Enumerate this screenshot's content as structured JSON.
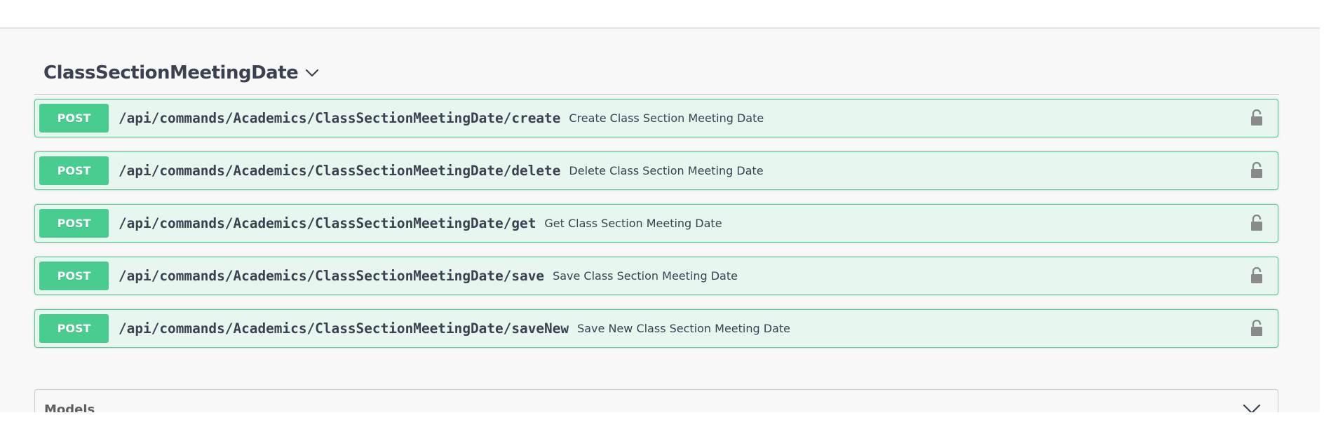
{
  "section": {
    "title": "ClassSectionMeetingDate"
  },
  "operations": [
    {
      "method": "POST",
      "path": "/api/commands/Academics/ClassSectionMeetingDate/create",
      "description": "Create Class Section Meeting Date"
    },
    {
      "method": "POST",
      "path": "/api/commands/Academics/ClassSectionMeetingDate/delete",
      "description": "Delete Class Section Meeting Date"
    },
    {
      "method": "POST",
      "path": "/api/commands/Academics/ClassSectionMeetingDate/get",
      "description": "Get Class Section Meeting Date"
    },
    {
      "method": "POST",
      "path": "/api/commands/Academics/ClassSectionMeetingDate/save",
      "description": "Save Class Section Meeting Date"
    },
    {
      "method": "POST",
      "path": "/api/commands/Academics/ClassSectionMeetingDate/saveNew",
      "description": "Save New Class Section Meeting Date"
    }
  ],
  "models": {
    "title": "Models"
  },
  "colors": {
    "post_accent": "#49cc90",
    "post_background": "#e8f6f0",
    "text": "#3b4151"
  }
}
